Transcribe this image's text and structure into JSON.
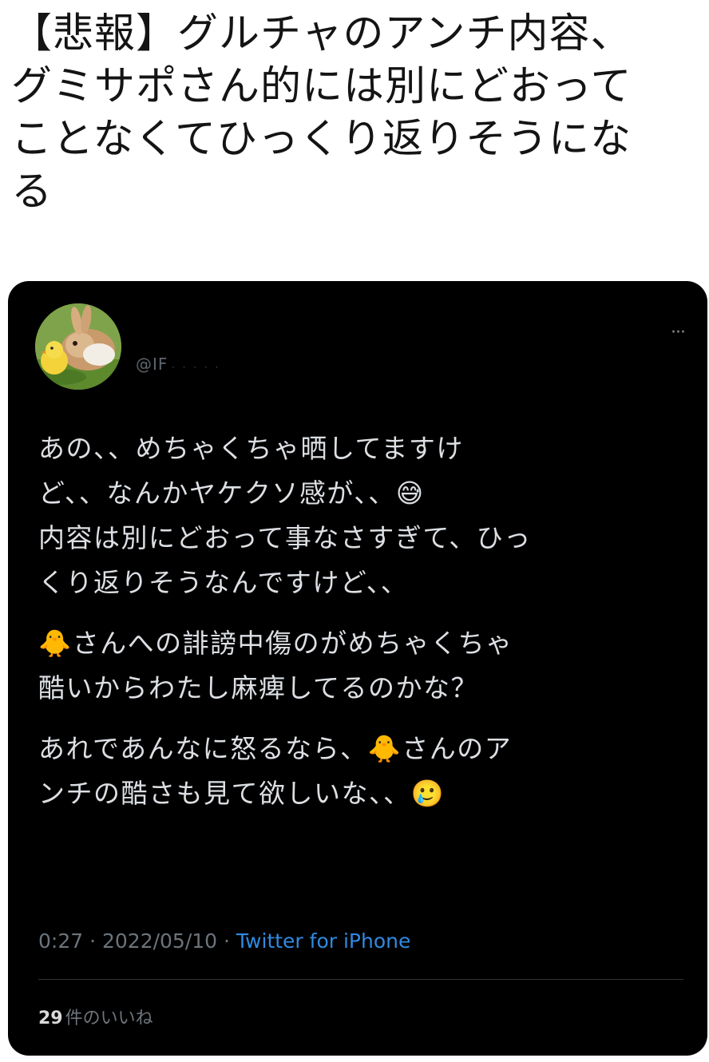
{
  "headline": "【悲報】グルチャのアンチ内容、\nグミサポさん的には別にどおって\nことなくてひっくり返りそうにな\nる",
  "tweet": {
    "handle_prefix": "@IF",
    "handle_mask": "· · · · ·",
    "more_label": "···",
    "paragraphs": [
      "あの、、めちゃくちゃ晒してますけ\nど、、なんかヤケクソ感が、、😅\n内容は別にどおって事なさすぎて、ひっ\nくり返りそうなんですけど、、",
      "🐥さんへの誹謗中傷のがめちゃくちゃ\n酷いからわたし麻痺してるのかな？",
      "あれであんなに怒るなら、🐥さんのア\nンチの酷さも見て欲しいな、、🥲"
    ],
    "time": "0:27",
    "date": "2022/05/10",
    "separator": " · ",
    "source": "Twitter for iPhone",
    "likes_count": "29",
    "likes_label": "件のいいね"
  },
  "colors": {
    "embed_bg": "#000000",
    "body_text": "#dcdfe3",
    "meta_text": "#6d747b",
    "source_link": "#2f8ae0"
  },
  "icons": {
    "avatar": "bunny-and-chick-photo",
    "more": "ellipsis-icon"
  }
}
